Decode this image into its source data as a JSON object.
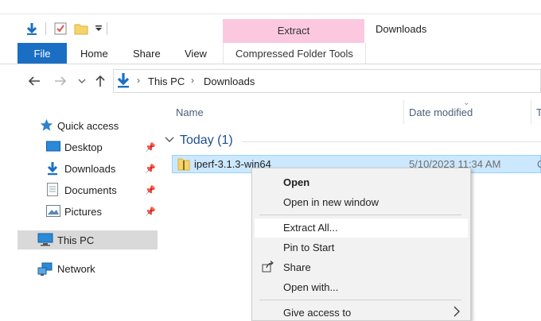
{
  "window": {
    "title": "Downloads",
    "context_group": "Extract"
  },
  "ribbon": {
    "tabs": [
      "File",
      "Home",
      "Share",
      "View"
    ],
    "context_tab": "Compressed Folder Tools"
  },
  "address": {
    "crumbs": [
      "This PC",
      "Downloads"
    ]
  },
  "nav_pane": {
    "quick_access": "Quick access",
    "items": [
      "Desktop",
      "Downloads",
      "Documents",
      "Pictures"
    ],
    "this_pc": "This PC",
    "network": "Network"
  },
  "columns": {
    "name": "Name",
    "date": "Date modified",
    "type_partial": "T"
  },
  "group": {
    "label": "Today (1)"
  },
  "file": {
    "name": "iperf-3.1.3-win64",
    "date": "5/10/2023 11:34 AM",
    "extra_partial": "C"
  },
  "context_menu": {
    "items": [
      "Open",
      "Open in new window",
      "Extract All...",
      "Pin to Start",
      "Share",
      "Open with...",
      "Give access to"
    ]
  },
  "colors": {
    "file_tab": "#1a6fc4",
    "context_header": "#fbc8e0",
    "selection": "#cce8ff",
    "group_label": "#1e4e8c",
    "nav_selected": "#d9d9d9"
  },
  "icons": {
    "qat": [
      "down-arrow-icon",
      "properties-icon",
      "new-folder-icon",
      "qat-dropdown-icon"
    ],
    "nav": [
      "back-icon",
      "forward-icon",
      "recent-dropdown-icon",
      "up-icon"
    ],
    "address": "downloads-folder-icon",
    "nav_pane": [
      "star-icon",
      "desktop-icon",
      "downloads-icon",
      "documents-icon",
      "pictures-icon",
      "pc-icon",
      "network-icon"
    ],
    "file": "zip-folder-icon",
    "menu": [
      "share-icon",
      "submenu-arrow-icon"
    ]
  }
}
